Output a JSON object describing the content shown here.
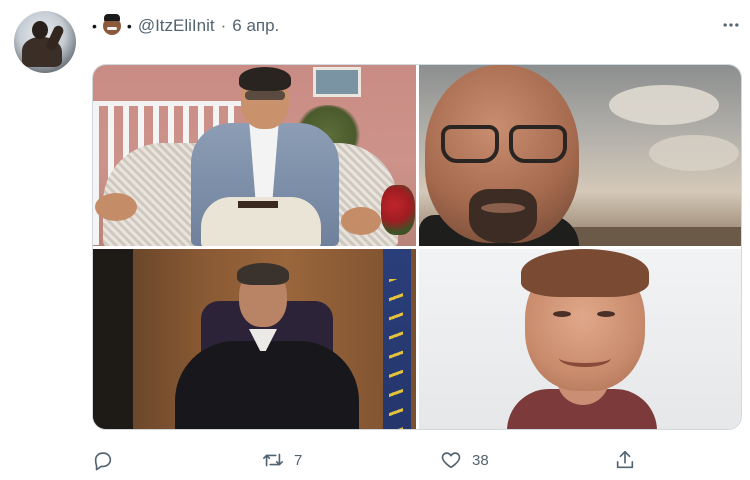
{
  "tweet": {
    "handle": "@ItzEliInit",
    "separator": "·",
    "date": "6 апр.",
    "bullet_left": "•",
    "bullet_right": "•"
  },
  "media": {
    "photos": [
      {
        "label": "photo-1"
      },
      {
        "label": "photo-2"
      },
      {
        "label": "photo-3"
      },
      {
        "label": "photo-4"
      }
    ]
  },
  "actions": {
    "replies": "",
    "retweets": "7",
    "likes": "38"
  },
  "icons": {
    "more": "more-icon",
    "reply": "reply-icon",
    "retweet": "retweet-icon",
    "like": "heart-icon",
    "share": "share-icon"
  },
  "colors": {
    "text_secondary": "#536471",
    "border": "#cfd9de",
    "background": "#ffffff"
  }
}
